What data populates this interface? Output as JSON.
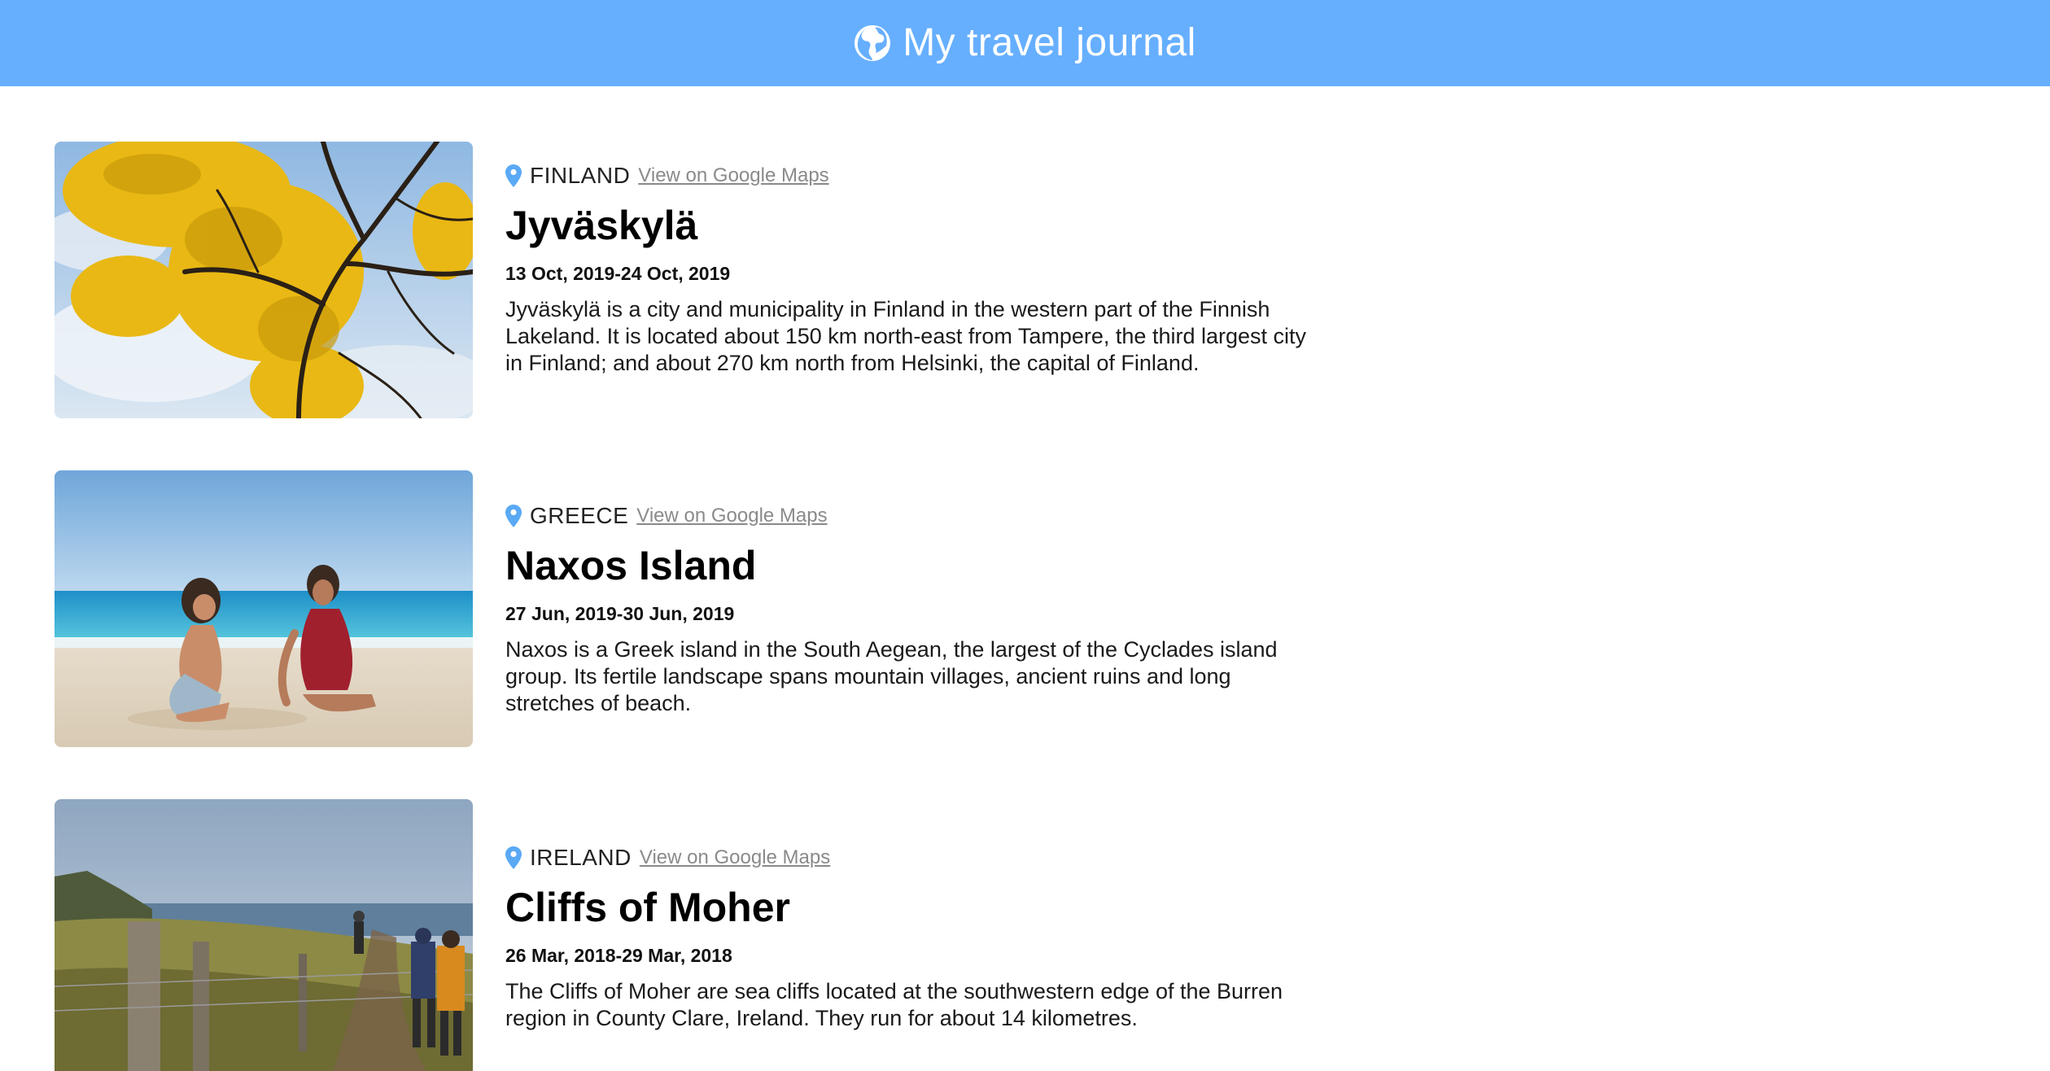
{
  "header": {
    "title": "My travel journal",
    "icon": "globe-icon",
    "background": "#66afff"
  },
  "entries": [
    {
      "country": "FINLAND",
      "maps_link": "View on Google Maps",
      "title": "Jyväskylä",
      "dates": "13 Oct, 2019-24 Oct, 2019",
      "description": "Jyväskylä is a city and municipality in Finland in the western part of the Finnish Lakeland. It is located about 150 km north-east from Tampere, the third largest city in Finland; and about 270 km north from Helsinki, the capital of Finland.",
      "photo": "autumn-tree-photo"
    },
    {
      "country": "GREECE",
      "maps_link": "View on Google Maps",
      "title": "Naxos Island",
      "dates": "27 Jun, 2019-30 Jun, 2019",
      "description": "Naxos is a Greek island in the South Aegean, the largest of the Cyclades island group. Its fertile landscape spans mountain villages, ancient ruins and long stretches of beach.",
      "photo": "beach-photo"
    },
    {
      "country": "IRELAND",
      "maps_link": "View on Google Maps",
      "title": "Cliffs of Moher",
      "dates": "26 Mar, 2018-29 Mar, 2018",
      "description": "The Cliffs of Moher are sea cliffs located at the southwestern edge of the Burren region in County Clare, Ireland. They run for about 14 kilometres.",
      "photo": "cliffs-photo"
    }
  ],
  "colors": {
    "accent": "#66afff",
    "pin": "#5aa9f5",
    "link": "#8a8a8a"
  }
}
